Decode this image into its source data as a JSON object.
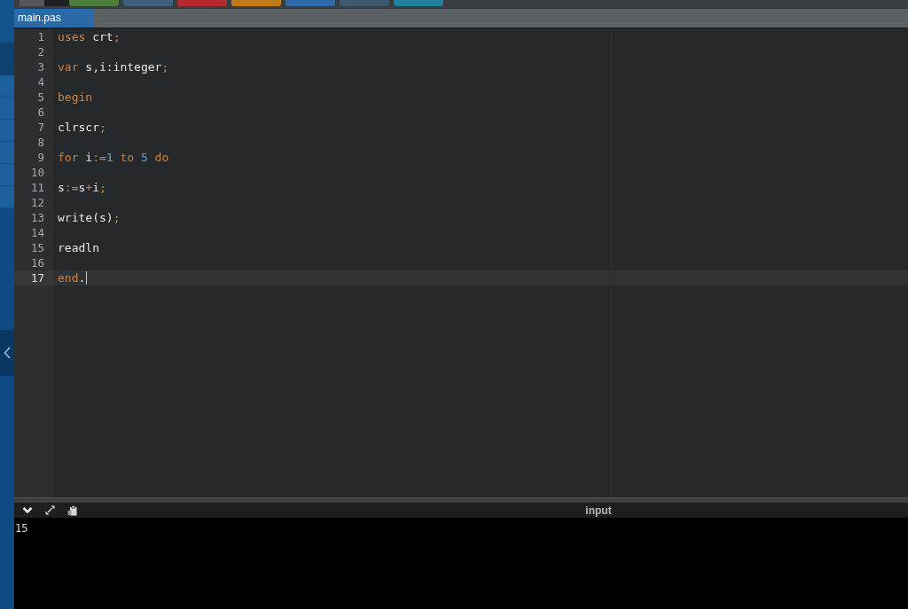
{
  "toolbar": {
    "buttons": [
      {
        "color": "#54585b"
      },
      {
        "color": "#1e2022"
      },
      {
        "color": "#4b7d3c"
      },
      {
        "color": "#3f5f7f"
      },
      {
        "color": "#b52a2c"
      },
      {
        "color": "#c47a1c"
      },
      {
        "color": "#2d6bac"
      },
      {
        "color": "#3c5a70"
      },
      {
        "color": "#21809e"
      }
    ]
  },
  "tabs": [
    {
      "label": "main.pas",
      "selected": true
    }
  ],
  "editor": {
    "lines": [
      {
        "number": "1",
        "active": false,
        "tokens": [
          {
            "text": "uses",
            "kind": "keyword"
          },
          {
            "text": " crt",
            "kind": "ident"
          },
          {
            "text": ";",
            "kind": "punct"
          }
        ]
      },
      {
        "number": "2",
        "active": false
      },
      {
        "number": "3",
        "active": false,
        "tokens": [
          {
            "text": "var",
            "kind": "keyword"
          },
          {
            "text": " s,i:integer",
            "kind": "ident"
          },
          {
            "text": ";",
            "kind": "punct"
          }
        ]
      },
      {
        "number": "4",
        "active": false
      },
      {
        "number": "5",
        "active": false,
        "tokens": [
          {
            "text": "begin",
            "kind": "keyword"
          }
        ]
      },
      {
        "number": "6",
        "active": false
      },
      {
        "number": "7",
        "active": false,
        "tokens": [
          {
            "text": "clrscr",
            "kind": "ident"
          },
          {
            "text": ";",
            "kind": "punct"
          }
        ]
      },
      {
        "number": "8",
        "active": false
      },
      {
        "number": "9",
        "active": false,
        "tokens": [
          {
            "text": "for",
            "kind": "keyword"
          },
          {
            "text": " i",
            "kind": "ident"
          },
          {
            "text": ":=",
            "kind": "punct"
          },
          {
            "text": "1",
            "kind": "number"
          },
          {
            "text": " to",
            "kind": "keyword"
          },
          {
            "text": " 5",
            "kind": "number"
          },
          {
            "text": " do",
            "kind": "keyword"
          }
        ]
      },
      {
        "number": "10",
        "active": false
      },
      {
        "number": "11",
        "active": false,
        "tokens": [
          {
            "text": "s",
            "kind": "ident"
          },
          {
            "text": ":=",
            "kind": "punct"
          },
          {
            "text": "s",
            "kind": "ident"
          },
          {
            "text": "+",
            "kind": "punct"
          },
          {
            "text": "i",
            "kind": "ident"
          },
          {
            "text": ";",
            "kind": "punct"
          }
        ]
      },
      {
        "number": "12",
        "active": false
      },
      {
        "number": "13",
        "active": false,
        "tokens": [
          {
            "text": "write(s)",
            "kind": "ident"
          },
          {
            "text": ";",
            "kind": "punct"
          }
        ]
      },
      {
        "number": "14",
        "active": false
      },
      {
        "number": "15",
        "active": false,
        "tokens": [
          {
            "text": "readln",
            "kind": "ident"
          }
        ]
      },
      {
        "number": "16",
        "active": false
      },
      {
        "number": "17",
        "active": true,
        "tokens": [
          {
            "text": "end",
            "kind": "keyword"
          },
          {
            "text": ".",
            "kind": "ident"
          }
        ]
      }
    ]
  },
  "console": {
    "input_label": "input",
    "output": "15"
  }
}
